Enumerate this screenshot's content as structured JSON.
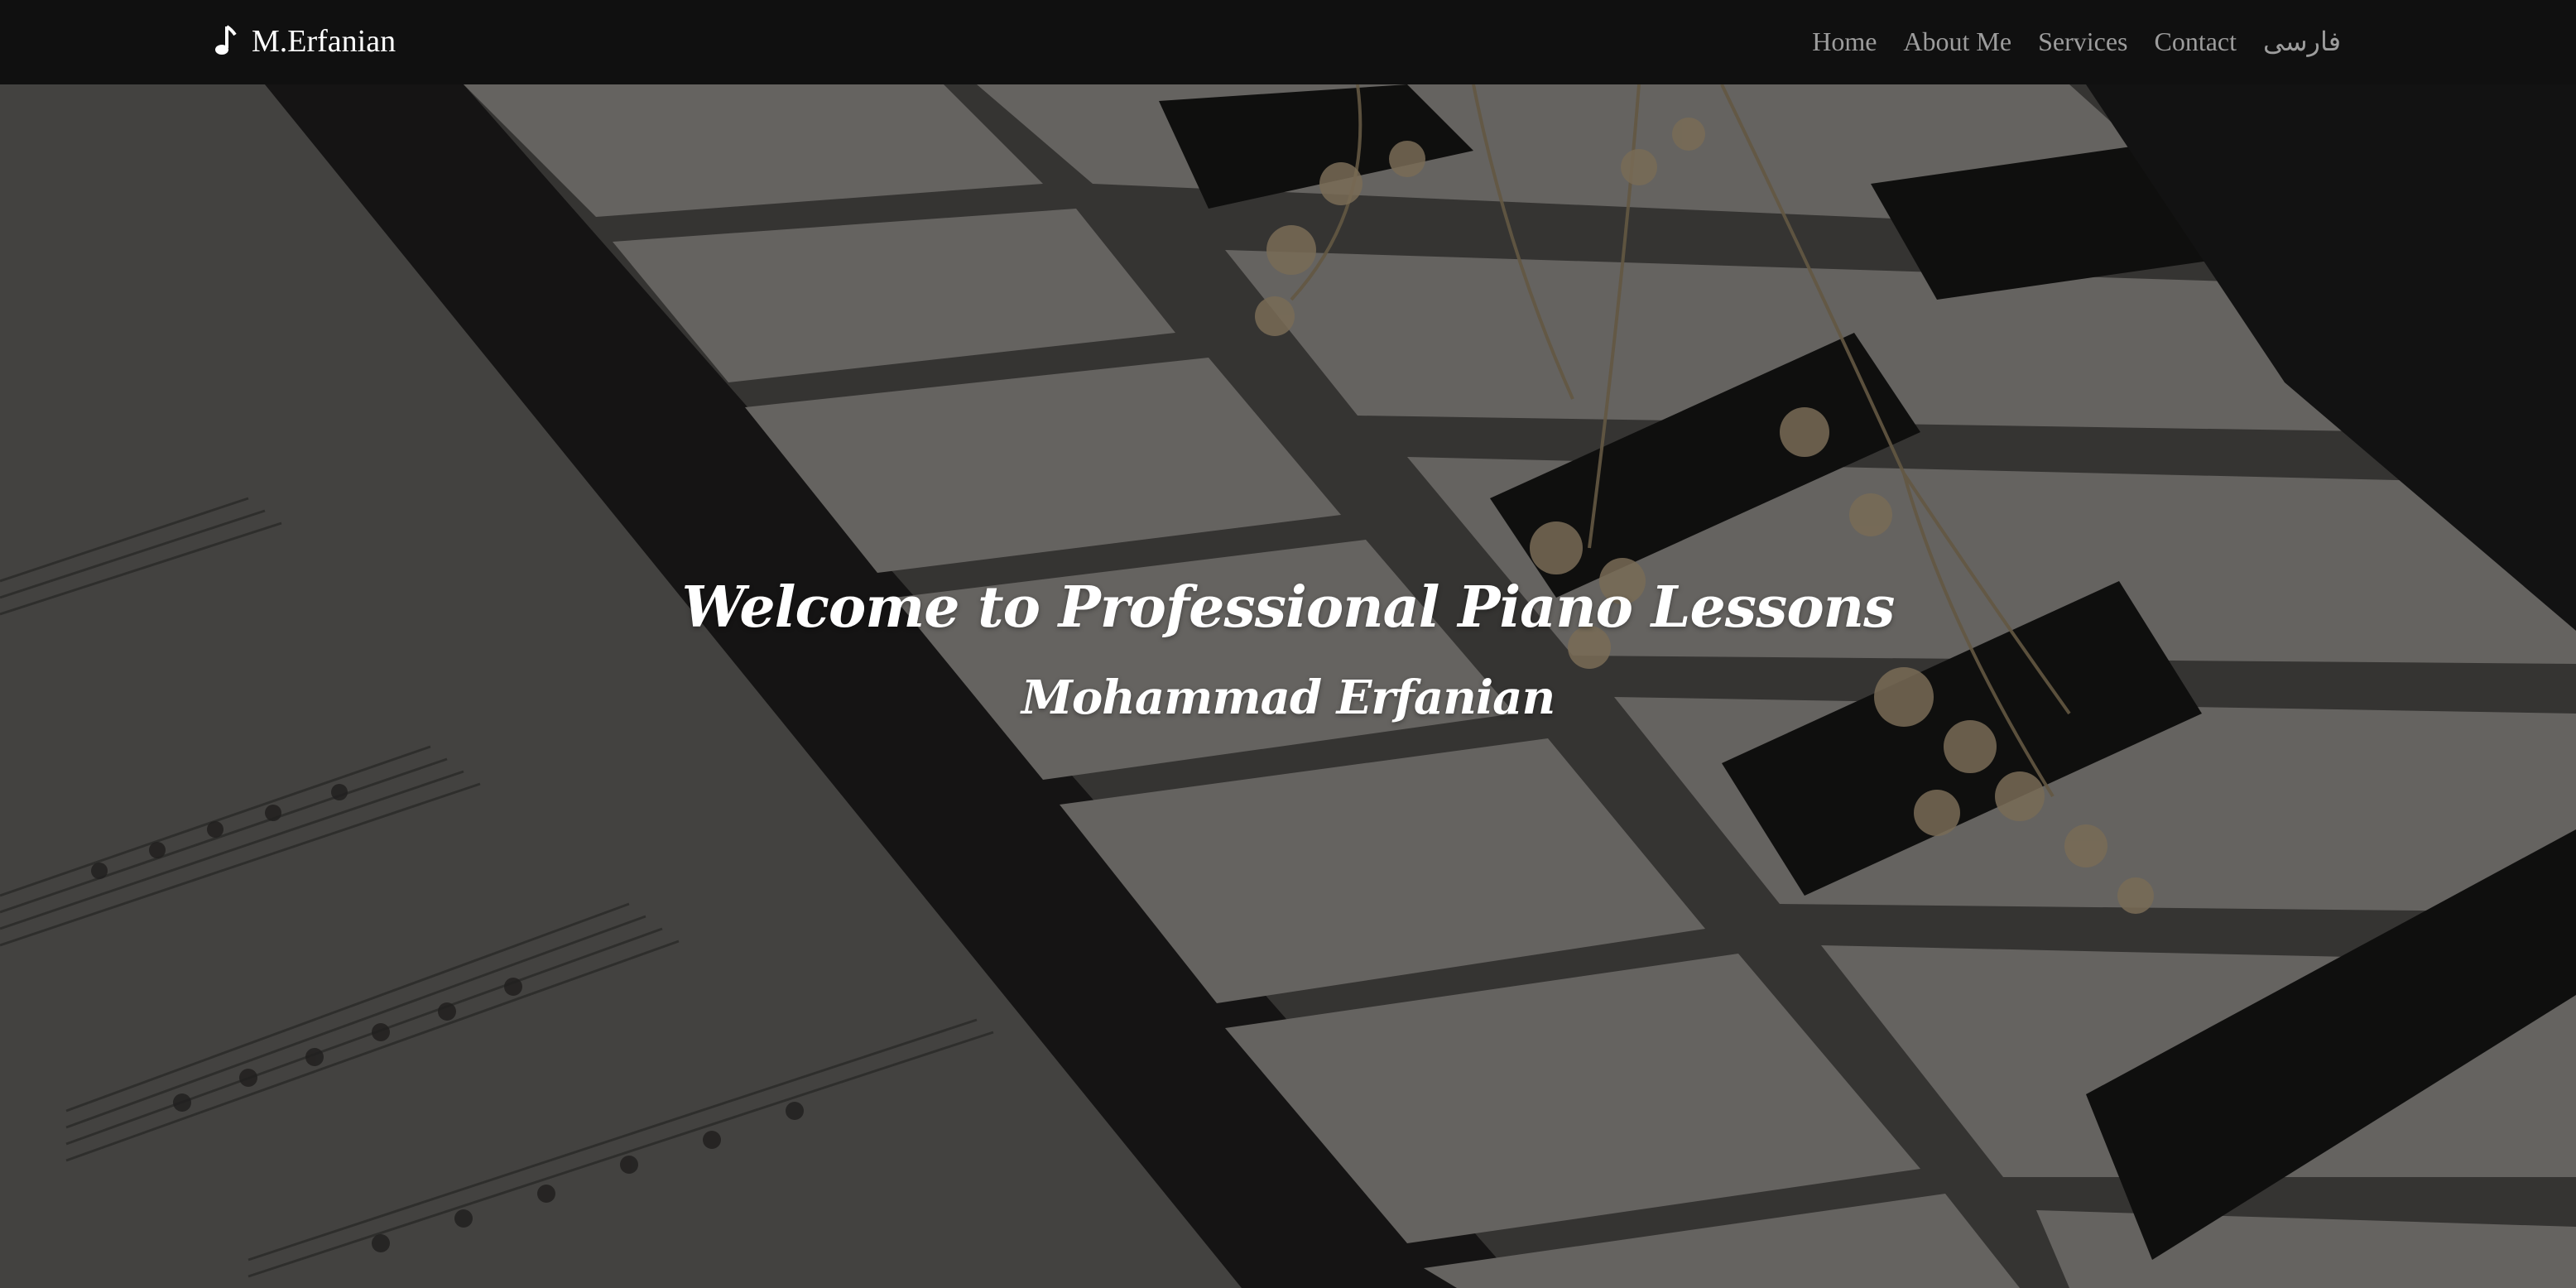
{
  "navbar": {
    "brand_icon": "music-note-icon",
    "brand": "M.Erfanian",
    "links": [
      "Home",
      "About Me",
      "Services",
      "Contact",
      "فارسی"
    ]
  },
  "hero": {
    "title": "Welcome to Professional Piano Lessons",
    "subtitle": "Mohammad Erfanian",
    "background": "piano-keys-sheet-music-photo"
  },
  "colors": {
    "navbar_bg": "#101010",
    "nav_link": "#9c9c9c",
    "brand_text": "#ffffff",
    "hero_text": "#ffffff"
  }
}
